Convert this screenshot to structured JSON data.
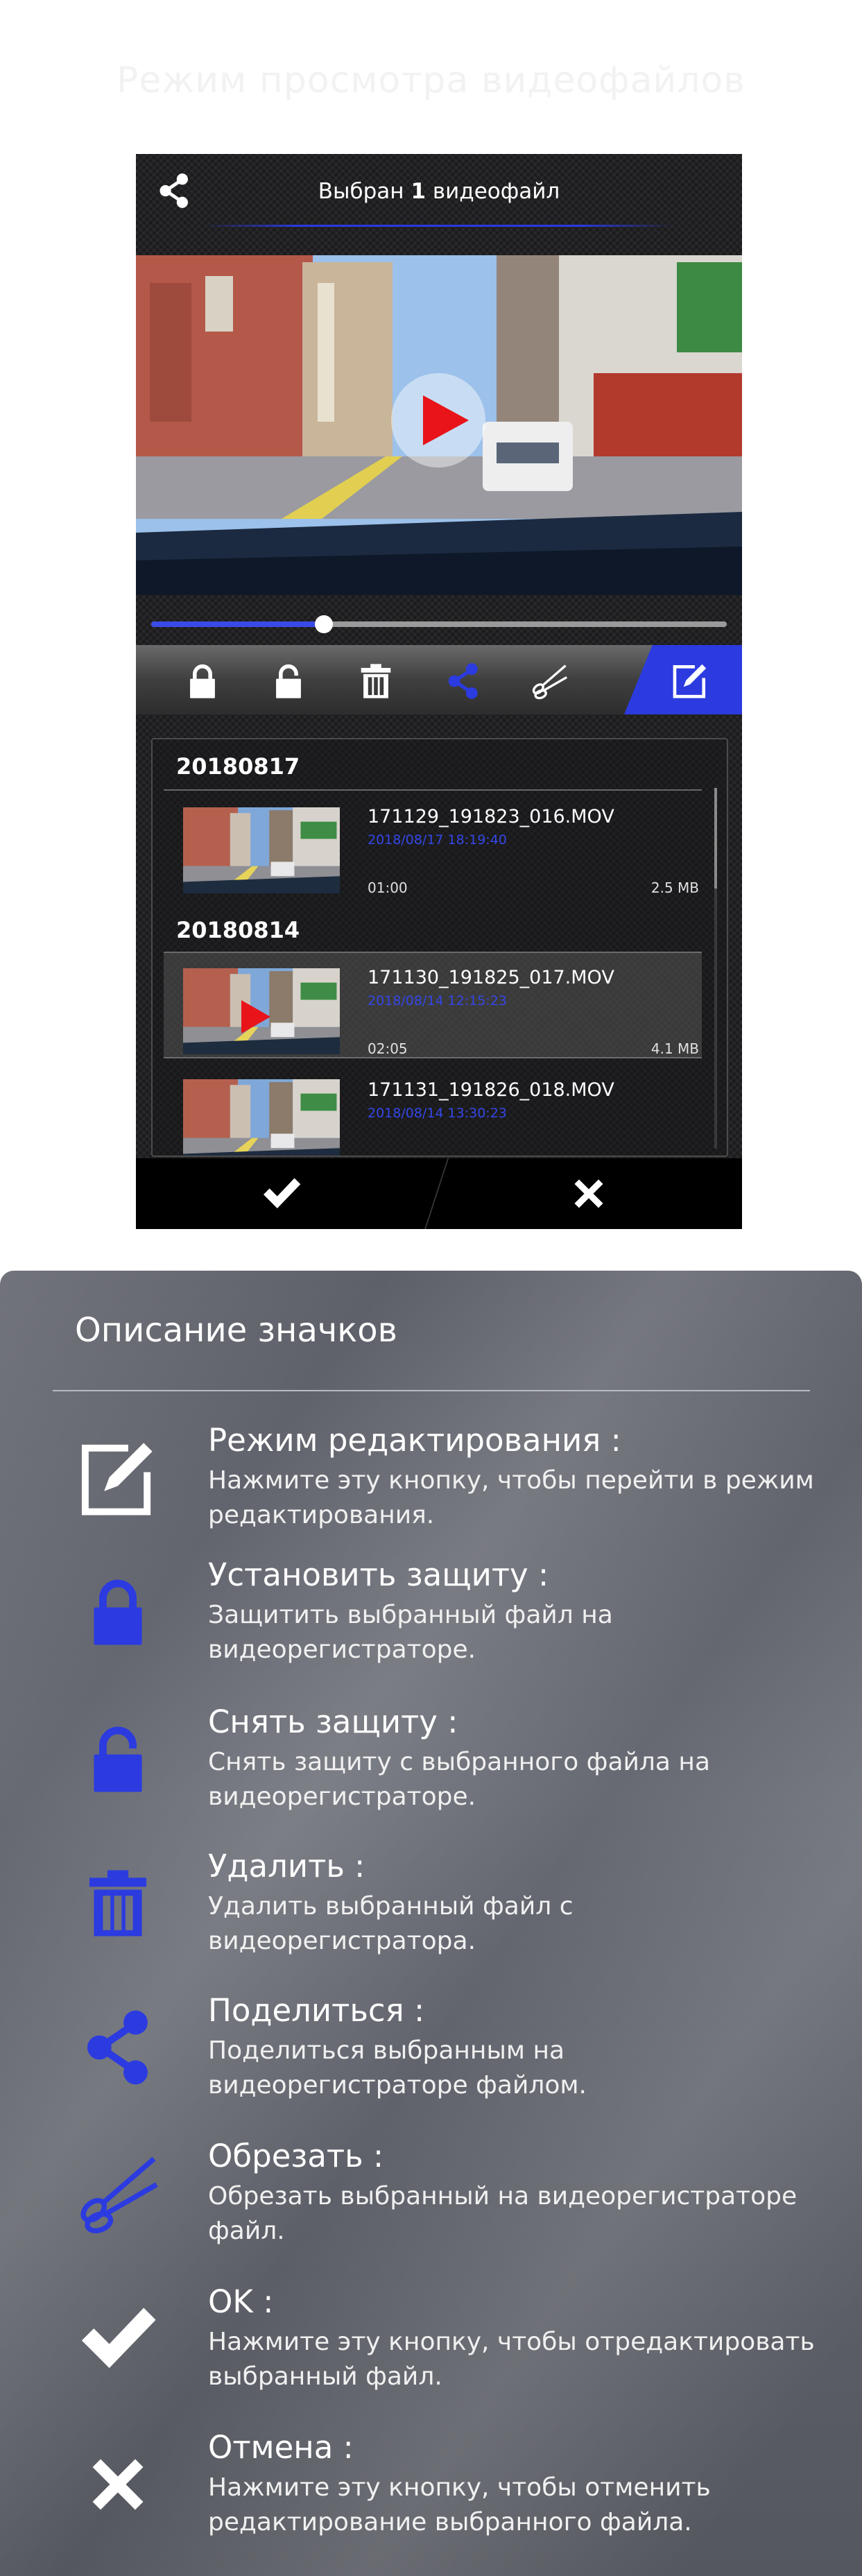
{
  "header": {
    "title": "Режим просмотра видеофайлов"
  },
  "screen": {
    "title_prefix": "Выбран",
    "title_count": "1",
    "title_suffix": "видеофайл",
    "progress": 0.3,
    "toolbar": [
      "lock-icon",
      "unlock-icon",
      "trash-icon",
      "share-icon",
      "scissors-icon",
      "edit-icon"
    ],
    "groups": [
      {
        "date": "20180817",
        "files": [
          {
            "name": "171129_191823_016.MOV",
            "datetime": "2018/08/17 18:19:40",
            "duration": "01:00",
            "size": "2.5 MB",
            "selected": false
          }
        ]
      },
      {
        "date": "20180814",
        "files": [
          {
            "name": "171130_191825_017.MOV",
            "datetime": "2018/08/14 12:15:23",
            "duration": "02:05",
            "size": "4.1 MB",
            "selected": true
          },
          {
            "name": "171131_191826_018.MOV",
            "datetime": "2018/08/14 13:30:23",
            "duration": "",
            "size": "",
            "selected": false
          }
        ]
      }
    ]
  },
  "legend": {
    "title": "Описание значков",
    "items": [
      {
        "icon": "edit-icon",
        "title": "Режим редактирования :",
        "text": "Нажмите эту кнопку, чтобы перейти в режим редактирования."
      },
      {
        "icon": "lock-icon",
        "title": "Установить защиту :",
        "text": "Защитить выбранный файл на видеорегистраторе."
      },
      {
        "icon": "unlock-icon",
        "title": "Снять защиту :",
        "text": "Снять защиту с выбранного файла на видеорегистраторе."
      },
      {
        "icon": "trash-icon",
        "title": "Удалить :",
        "text": "Удалить выбранный файл с видеорегистратора."
      },
      {
        "icon": "share-icon",
        "title": "Поделиться :",
        "text": "Поделиться выбранным на видеорегистраторе файлом."
      },
      {
        "icon": "scissors-icon",
        "title": "Обрезать :",
        "text": "Обрезать выбранный на видеорегистраторе файл."
      },
      {
        "icon": "check-icon",
        "title": "OK :",
        "text": "Нажмите эту кнопку, чтобы отредактировать выбранный файл."
      },
      {
        "icon": "close-icon",
        "title": "Отмена :",
        "text": "Нажмите эту кнопку, чтобы отменить редактирование выбранного файла."
      }
    ]
  },
  "colors": {
    "accent": "#2b3be0",
    "file_date": "#3447e6",
    "play": "#e8141a",
    "phone_bg": "#1b1b1d"
  }
}
